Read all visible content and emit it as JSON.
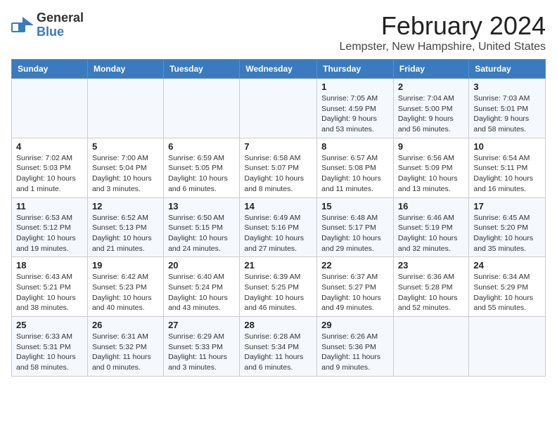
{
  "header": {
    "logo_general": "General",
    "logo_blue": "Blue",
    "month_title": "February 2024",
    "location": "Lempster, New Hampshire, United States"
  },
  "days_of_week": [
    "Sunday",
    "Monday",
    "Tuesday",
    "Wednesday",
    "Thursday",
    "Friday",
    "Saturday"
  ],
  "weeks": [
    [
      {
        "day": "",
        "info": ""
      },
      {
        "day": "",
        "info": ""
      },
      {
        "day": "",
        "info": ""
      },
      {
        "day": "",
        "info": ""
      },
      {
        "day": "1",
        "info": "Sunrise: 7:05 AM\nSunset: 4:59 PM\nDaylight: 9 hours and 53 minutes."
      },
      {
        "day": "2",
        "info": "Sunrise: 7:04 AM\nSunset: 5:00 PM\nDaylight: 9 hours and 56 minutes."
      },
      {
        "day": "3",
        "info": "Sunrise: 7:03 AM\nSunset: 5:01 PM\nDaylight: 9 hours and 58 minutes."
      }
    ],
    [
      {
        "day": "4",
        "info": "Sunrise: 7:02 AM\nSunset: 5:03 PM\nDaylight: 10 hours and 1 minute."
      },
      {
        "day": "5",
        "info": "Sunrise: 7:00 AM\nSunset: 5:04 PM\nDaylight: 10 hours and 3 minutes."
      },
      {
        "day": "6",
        "info": "Sunrise: 6:59 AM\nSunset: 5:05 PM\nDaylight: 10 hours and 6 minutes."
      },
      {
        "day": "7",
        "info": "Sunrise: 6:58 AM\nSunset: 5:07 PM\nDaylight: 10 hours and 8 minutes."
      },
      {
        "day": "8",
        "info": "Sunrise: 6:57 AM\nSunset: 5:08 PM\nDaylight: 10 hours and 11 minutes."
      },
      {
        "day": "9",
        "info": "Sunrise: 6:56 AM\nSunset: 5:09 PM\nDaylight: 10 hours and 13 minutes."
      },
      {
        "day": "10",
        "info": "Sunrise: 6:54 AM\nSunset: 5:11 PM\nDaylight: 10 hours and 16 minutes."
      }
    ],
    [
      {
        "day": "11",
        "info": "Sunrise: 6:53 AM\nSunset: 5:12 PM\nDaylight: 10 hours and 19 minutes."
      },
      {
        "day": "12",
        "info": "Sunrise: 6:52 AM\nSunset: 5:13 PM\nDaylight: 10 hours and 21 minutes."
      },
      {
        "day": "13",
        "info": "Sunrise: 6:50 AM\nSunset: 5:15 PM\nDaylight: 10 hours and 24 minutes."
      },
      {
        "day": "14",
        "info": "Sunrise: 6:49 AM\nSunset: 5:16 PM\nDaylight: 10 hours and 27 minutes."
      },
      {
        "day": "15",
        "info": "Sunrise: 6:48 AM\nSunset: 5:17 PM\nDaylight: 10 hours and 29 minutes."
      },
      {
        "day": "16",
        "info": "Sunrise: 6:46 AM\nSunset: 5:19 PM\nDaylight: 10 hours and 32 minutes."
      },
      {
        "day": "17",
        "info": "Sunrise: 6:45 AM\nSunset: 5:20 PM\nDaylight: 10 hours and 35 minutes."
      }
    ],
    [
      {
        "day": "18",
        "info": "Sunrise: 6:43 AM\nSunset: 5:21 PM\nDaylight: 10 hours and 38 minutes."
      },
      {
        "day": "19",
        "info": "Sunrise: 6:42 AM\nSunset: 5:23 PM\nDaylight: 10 hours and 40 minutes."
      },
      {
        "day": "20",
        "info": "Sunrise: 6:40 AM\nSunset: 5:24 PM\nDaylight: 10 hours and 43 minutes."
      },
      {
        "day": "21",
        "info": "Sunrise: 6:39 AM\nSunset: 5:25 PM\nDaylight: 10 hours and 46 minutes."
      },
      {
        "day": "22",
        "info": "Sunrise: 6:37 AM\nSunset: 5:27 PM\nDaylight: 10 hours and 49 minutes."
      },
      {
        "day": "23",
        "info": "Sunrise: 6:36 AM\nSunset: 5:28 PM\nDaylight: 10 hours and 52 minutes."
      },
      {
        "day": "24",
        "info": "Sunrise: 6:34 AM\nSunset: 5:29 PM\nDaylight: 10 hours and 55 minutes."
      }
    ],
    [
      {
        "day": "25",
        "info": "Sunrise: 6:33 AM\nSunset: 5:31 PM\nDaylight: 10 hours and 58 minutes."
      },
      {
        "day": "26",
        "info": "Sunrise: 6:31 AM\nSunset: 5:32 PM\nDaylight: 11 hours and 0 minutes."
      },
      {
        "day": "27",
        "info": "Sunrise: 6:29 AM\nSunset: 5:33 PM\nDaylight: 11 hours and 3 minutes."
      },
      {
        "day": "28",
        "info": "Sunrise: 6:28 AM\nSunset: 5:34 PM\nDaylight: 11 hours and 6 minutes."
      },
      {
        "day": "29",
        "info": "Sunrise: 6:26 AM\nSunset: 5:36 PM\nDaylight: 11 hours and 9 minutes."
      },
      {
        "day": "",
        "info": ""
      },
      {
        "day": "",
        "info": ""
      }
    ]
  ]
}
